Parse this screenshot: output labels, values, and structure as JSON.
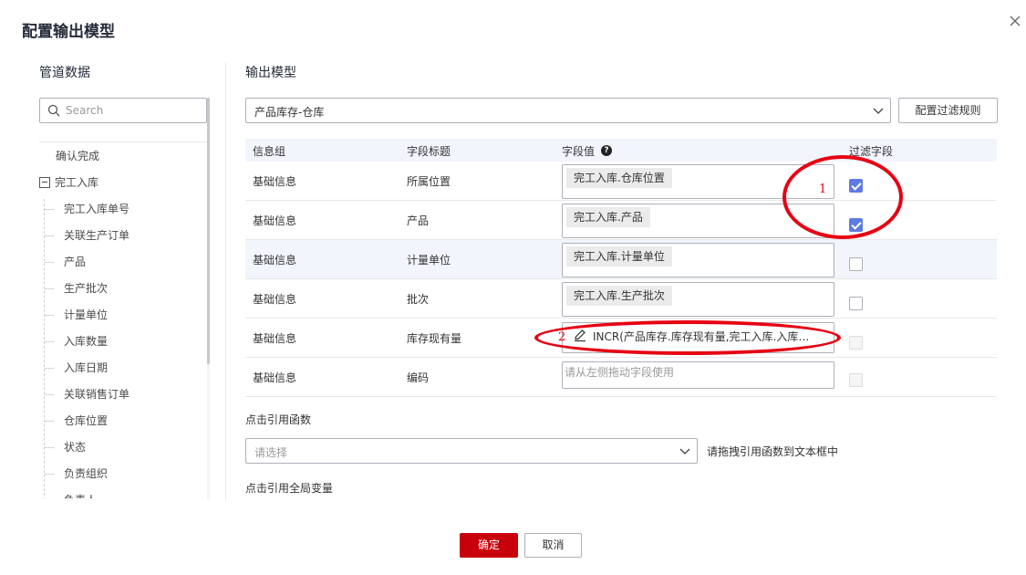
{
  "dialog": {
    "title": "配置输出模型"
  },
  "pipeline": {
    "title": "管道数据",
    "search_placeholder": "Search",
    "tree": {
      "first_item": "确认完成",
      "root": "完工入库",
      "children": [
        "完工入库单号",
        "关联生产订单",
        "产品",
        "生产批次",
        "计量单位",
        "入库数量",
        "入库日期",
        "关联销售订单",
        "仓库位置",
        "状态",
        "负责组织",
        "负责人"
      ]
    }
  },
  "output": {
    "title": "输出模型",
    "model_value": "产品库存-仓库",
    "filter_button": "配置过滤规则",
    "columns": {
      "group": "信息组",
      "field_title": "字段标题",
      "field_value": "字段值",
      "filter": "过滤字段"
    },
    "help_glyph": "?",
    "rows": [
      {
        "group": "基础信息",
        "title": "所属位置",
        "value": "完工入库.仓库位置",
        "filter": "checked"
      },
      {
        "group": "基础信息",
        "title": "产品",
        "value": "完工入库.产品",
        "filter": "checked"
      },
      {
        "group": "基础信息",
        "title": "计量单位",
        "value": "完工入库.计量单位",
        "filter": "unchecked"
      },
      {
        "group": "基础信息",
        "title": "批次",
        "value": "完工入库.生产批次",
        "filter": "unchecked"
      },
      {
        "group": "基础信息",
        "title": "库存现有量",
        "value": "INCR(产品库存.库存现有量,完工入库.入库…",
        "filter": "disabled"
      },
      {
        "group": "基础信息",
        "title": "编码",
        "placeholder": "请从左侧拖动字段使用",
        "filter": "disabled"
      }
    ]
  },
  "functions": {
    "label": "点击引用函数",
    "select_placeholder": "请选择",
    "hint": "请拖拽引用函数到文本框中"
  },
  "globals": {
    "label": "点击引用全局变量"
  },
  "footer": {
    "ok": "确定",
    "cancel": "取消"
  },
  "annotations": {
    "marker1": "1",
    "marker2": "2"
  },
  "colors": {
    "primary": "#c7000b",
    "checkbox": "#5e7ce0",
    "annotation": "#e60012"
  }
}
